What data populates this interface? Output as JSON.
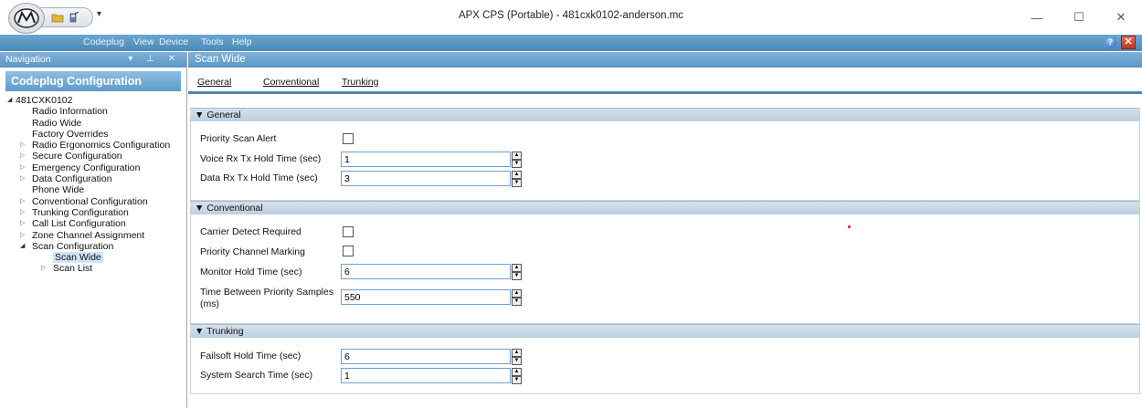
{
  "window": {
    "title": "APX CPS (Portable) - 481cxk0102-anderson.mc",
    "controls": [
      "minimize",
      "maximize",
      "close"
    ]
  },
  "menu": {
    "items": [
      "Codeplug",
      "View",
      "Device",
      "Tools",
      "Help"
    ]
  },
  "navigation": {
    "header": "Navigation",
    "title": "Codeplug Configuration",
    "tree": [
      {
        "label": "481CXK0102",
        "level": 0,
        "arrow": "open"
      },
      {
        "label": "Radio Information",
        "level": 1,
        "arrow": "none"
      },
      {
        "label": "Radio Wide",
        "level": 1,
        "arrow": "none"
      },
      {
        "label": "Factory Overrides",
        "level": 1,
        "arrow": "none"
      },
      {
        "label": "Radio Ergonomics Configuration",
        "level": 1,
        "arrow": "closed"
      },
      {
        "label": "Secure Configuration",
        "level": 1,
        "arrow": "closed"
      },
      {
        "label": "Emergency Configuration",
        "level": 1,
        "arrow": "closed"
      },
      {
        "label": "Data Configuration",
        "level": 1,
        "arrow": "closed"
      },
      {
        "label": "Phone Wide",
        "level": 1,
        "arrow": "none"
      },
      {
        "label": "Conventional Configuration",
        "level": 1,
        "arrow": "closed"
      },
      {
        "label": "Trunking Configuration",
        "level": 1,
        "arrow": "closed"
      },
      {
        "label": "Call List Configuration",
        "level": 1,
        "arrow": "closed"
      },
      {
        "label": "Zone Channel Assignment",
        "level": 1,
        "arrow": "closed"
      },
      {
        "label": "Scan Configuration",
        "level": 1,
        "arrow": "open"
      },
      {
        "label": "Scan Wide",
        "level": 2,
        "arrow": "none",
        "selected": true
      },
      {
        "label": "Scan List",
        "level": 2,
        "arrow": "closed"
      }
    ]
  },
  "main": {
    "header": "Scan Wide",
    "tabs": [
      "General",
      "Conventional",
      "Trunking"
    ],
    "sections": {
      "general": {
        "title": "General",
        "priority_scan_alert": {
          "label": "Priority Scan Alert",
          "checked": false
        },
        "voice_rx_tx": {
          "label": "Voice Rx Tx Hold Time (sec)",
          "value": "1"
        },
        "data_rx_tx": {
          "label": "Data Rx Tx Hold Time (sec)",
          "value": "3"
        }
      },
      "conventional": {
        "title": "Conventional",
        "carrier_detect": {
          "label": "Carrier Detect Required",
          "checked": false
        },
        "priority_channel_marking": {
          "label": "Priority Channel Marking",
          "checked": false
        },
        "monitor_hold": {
          "label": "Monitor Hold Time (sec)",
          "value": "6"
        },
        "time_between_priority": {
          "label_line1": "Time Between Priority Samples",
          "label_line2": "(ms)",
          "value": "550"
        }
      },
      "trunking": {
        "title": "Trunking",
        "failsoft_hold": {
          "label": "Failsoft Hold Time (sec)",
          "value": "6"
        },
        "system_search": {
          "label": "System Search Time (sec)",
          "value": "1"
        }
      }
    }
  },
  "icons": {
    "app_logo": "motorola-logo-icon",
    "help": "help-icon",
    "close_doc": "close-icon"
  },
  "colors": {
    "accent": "#5b97c6",
    "section_header": "#c9d9e7",
    "input_border": "#6f9fd0",
    "selected_item": "#cfe4f7"
  }
}
